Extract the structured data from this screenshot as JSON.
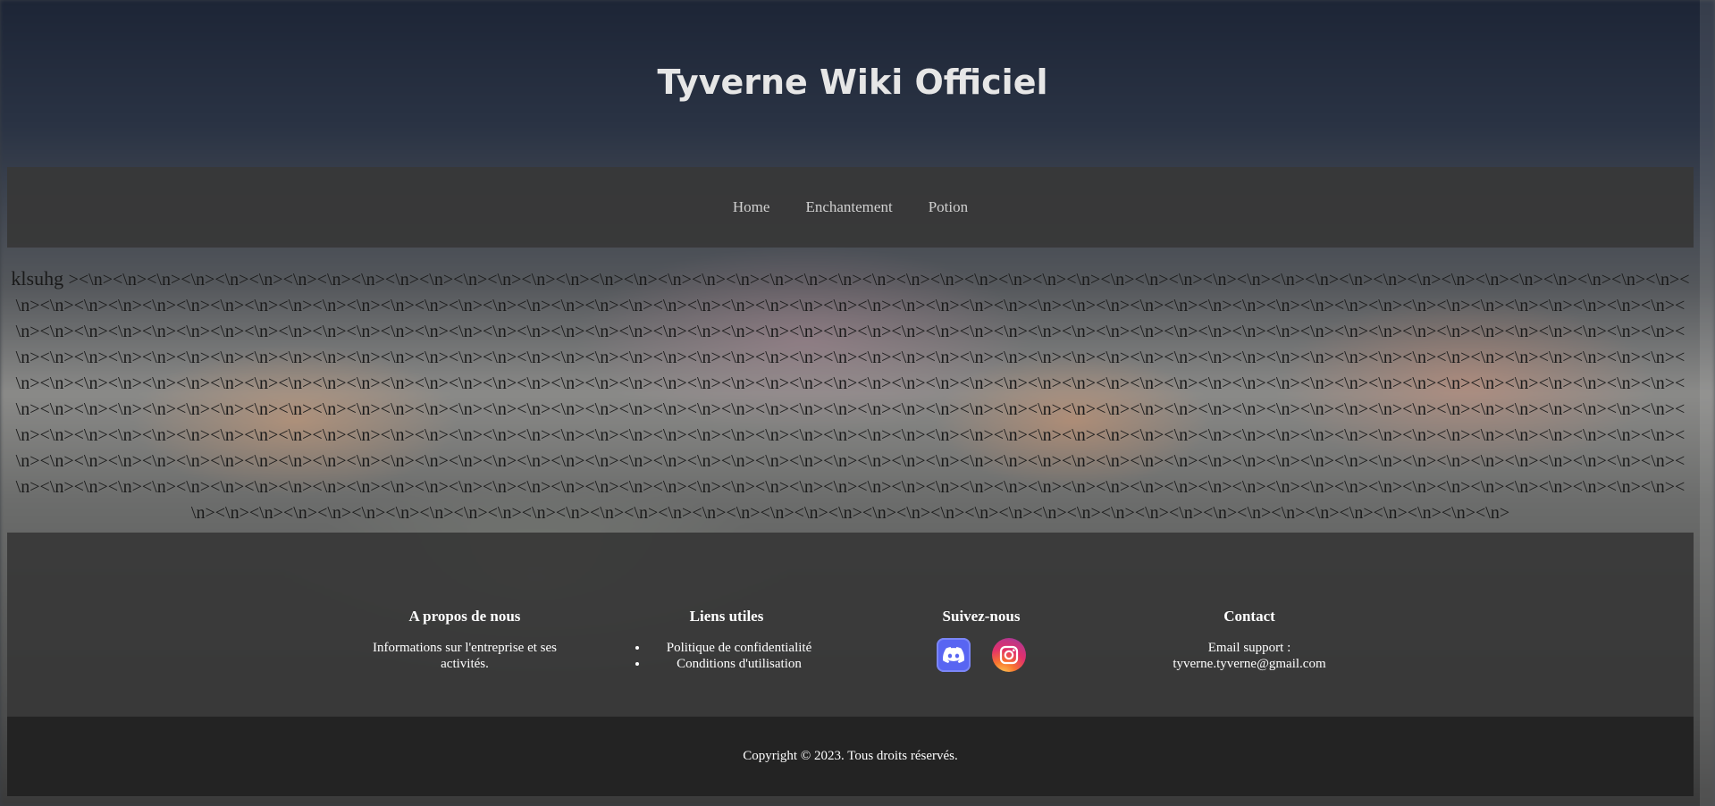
{
  "site": {
    "title": "Tyverne Wiki Officiel"
  },
  "nav": {
    "items": [
      {
        "label": "Home"
      },
      {
        "label": "Enchantement"
      },
      {
        "label": "Potion"
      }
    ]
  },
  "main": {
    "lead_text": "klsuhg",
    "body_text": "><\\n><\\n><\\n><\\n><\\n><\\n><\\n><\\n><\\n><\\n><\\n><\\n><\\n><\\n><\\n><\\n><\\n><\\n><\\n><\\n><\\n><\\n><\\n><\\n><\\n><\\n><\\n><\\n><\\n><\\n><\\n><\\n><\\n><\\n><\\n><\\n><\\n><\\n><\\n><\\n><\\n><\\n><\\n><\\n><\\n><\\n><\\n><\\n><\\n><\\n><\\n><\\n><\\n><\\n><\\n><\\n><\\n><\\n><\\n><\\n><\\n><\\n><\\n><\\n><\\n><\\n><\\n><\\n><\\n><\\n><\\n><\\n><\\n><\\n><\\n><\\n><\\n><\\n><\\n><\\n><\\n><\\n><\\n><\\n><\\n><\\n><\\n><\\n><\\n><\\n><\\n><\\n><\\n><\\n><\\n><\\n><\\n><\\n><\\n><\\n><\\n><\\n><\\n><\\n><\\n><\\n><\\n><\\n><\\n><\\n><\\n><\\n><\\n><\\n><\\n><\\n><\\n><\\n><\\n><\\n><\\n><\\n><\\n><\\n><\\n><\\n><\\n><\\n><\\n><\\n><\\n><\\n><\\n><\\n><\\n><\\n><\\n><\\n><\\n><\\n><\\n><\\n><\\n><\\n><\\n><\\n><\\n><\\n><\\n><\\n><\\n><\\n><\\n><\\n><\\n><\\n><\\n><\\n><\\n><\\n><\\n><\\n><\\n><\\n><\\n><\\n><\\n><\\n><\\n><\\n><\\n><\\n><\\n><\\n><\\n><\\n><\\n><\\n><\\n><\\n><\\n><\\n><\\n><\\n><\\n><\\n><\\n><\\n><\\n><\\n><\\n><\\n><\\n><\\n><\\n><\\n><\\n><\\n><\\n><\\n><\\n><\\n><\\n><\\n><\\n><\\n><\\n><\\n><\\n><\\n><\\n><\\n><\\n><\\n><\\n><\\n><\\n><\\n><\\n><\\n><\\n><\\n><\\n><\\n><\\n><\\n><\\n><\\n><\\n><\\n><\\n><\\n><\\n><\\n><\\n><\\n><\\n><\\n><\\n><\\n><\\n><\\n><\\n><\\n><\\n><\\n><\\n><\\n><\\n><\\n><\\n><\\n><\\n><\\n><\\n><\\n><\\n><\\n><\\n><\\n><\\n><\\n><\\n><\\n><\\n><\\n><\\n><\\n><\\n><\\n><\\n><\\n><\\n><\\n><\\n><\\n><\\n><\\n><\\n><\\n><\\n><\\n><\\n><\\n><\\n><\\n><\\n><\\n><\\n><\\n><\\n><\\n><\\n><\\n><\\n><\\n><\\n><\\n><\\n><\\n><\\n><\\n><\\n><\\n><\\n><\\n><\\n><\\n><\\n><\\n><\\n><\\n><\\n><\\n><\\n><\\n><\\n><\\n><\\n><\\n><\\n><\\n><\\n><\\n><\\n><\\n><\\n><\\n><\\n><\\n><\\n><\\n><\\n><\\n><\\n><\\n><\\n><\\n><\\n><\\n><\\n><\\n><\\n><\\n><\\n><\\n><\\n><\\n><\\n><\\n><\\n><\\n><\\n><\\n><\\n><\\n><\\n><\\n><\\n><\\n><\\n><\\n><\\n><\\n><\\n><\\n><\\n><\\n><\\n><\\n><\\n><\\n><\\n><\\n><\\n><\\n><\\n><\\n><\\n><\\n><\\n><\\n><\\n><\\n><\\n><\\n><\\n><\\n><\\n><\\n><\\n><\\n><\\n><\\n><\\n><\\n><\\n><\\n><\\n><\\n><\\n><\\n><\\n><\\n><\\n><\\n><\\n><\\n><\\n><\\n><\\n><\\n><\\n><\\n><\\n><\\n><\\n><\\n><\\n><\\n><\\n><\\n><\\n><\\n><\\n><\\n><\\n><\\n><\\n><\\n><\\n><\\n><\\n><\\n><\\n><\\n><\\n><\\n><\\n><\\n><\\n><\\n><\\n><\\n><\\n><\\n><\\n><\\n><\\n><\\n><\\n><\\n><\\n><\\n><\\n><\\n><\\n><\\n><\\n><\\n><\\n><\\n><\\n><\\n><\\n><\\n><\\n><\\n><\\n><\\n><\\n><\\n><\\n><\\n><\\n><\\n><\\n><\\n>"
  },
  "footer": {
    "about": {
      "title": "A propos de nous",
      "text": "Informations sur l'entreprise et ses activités."
    },
    "links": {
      "title": "Liens utiles",
      "items": [
        {
          "label": "Politique de confidentialité"
        },
        {
          "label": "Conditions d'utilisation"
        }
      ]
    },
    "social": {
      "title": "Suivez-nous",
      "icons": [
        "discord-icon",
        "instagram-icon"
      ]
    },
    "contact": {
      "title": "Contact",
      "text": "Email support : tyverne.tyverne@gmail.com"
    },
    "copyright": "Copyright © 2023. Tous droits réservés."
  }
}
